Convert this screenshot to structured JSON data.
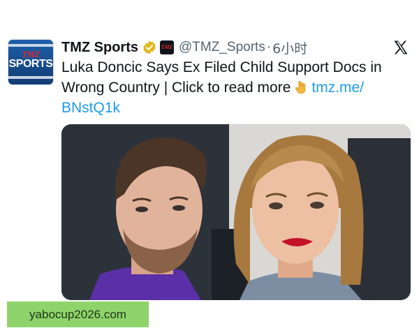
{
  "tweet": {
    "display_name": "TMZ Sports",
    "handle": "@TMZ_Sports",
    "separator": "·",
    "time": "6小时",
    "body_text": "Luka Doncic Says Ex Filed Child Support Docs in Wrong Country",
    "divider": "|",
    "cta_text": "Click to read more",
    "link_text_1": "tmz.me/",
    "link_text_2": "BNstQ1k"
  },
  "avatar": {
    "brand_top": "TMZ",
    "brand_main": "SPORTS"
  },
  "affiliate_badge": {
    "text": "TMZ"
  },
  "icons": {
    "verified": "verified-gold-badge",
    "affiliate": "tmz-affiliate-badge",
    "platform": "x-logo",
    "emoji": "backhand-index-pointing-down"
  },
  "colors": {
    "link": "#1d9bf0",
    "secondary_text": "#536471",
    "verified_gold": "#e2b719",
    "watermark_bg": "#8fd46b"
  },
  "watermark": {
    "text": "yabocup2026.com"
  }
}
